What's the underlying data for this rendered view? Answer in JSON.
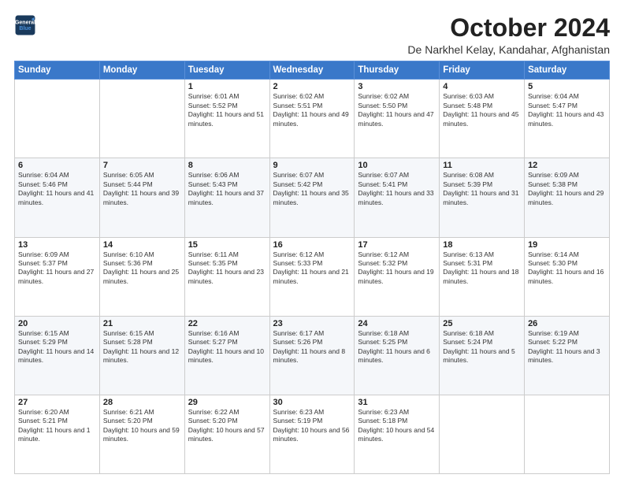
{
  "logo": {
    "line1": "General",
    "line2": "Blue"
  },
  "title": "October 2024",
  "location": "De Narkhel Kelay, Kandahar, Afghanistan",
  "weekdays": [
    "Sunday",
    "Monday",
    "Tuesday",
    "Wednesday",
    "Thursday",
    "Friday",
    "Saturday"
  ],
  "weeks": [
    [
      {
        "day": null
      },
      {
        "day": null
      },
      {
        "day": "1",
        "sunrise": "Sunrise: 6:01 AM",
        "sunset": "Sunset: 5:52 PM",
        "daylight": "Daylight: 11 hours and 51 minutes."
      },
      {
        "day": "2",
        "sunrise": "Sunrise: 6:02 AM",
        "sunset": "Sunset: 5:51 PM",
        "daylight": "Daylight: 11 hours and 49 minutes."
      },
      {
        "day": "3",
        "sunrise": "Sunrise: 6:02 AM",
        "sunset": "Sunset: 5:50 PM",
        "daylight": "Daylight: 11 hours and 47 minutes."
      },
      {
        "day": "4",
        "sunrise": "Sunrise: 6:03 AM",
        "sunset": "Sunset: 5:48 PM",
        "daylight": "Daylight: 11 hours and 45 minutes."
      },
      {
        "day": "5",
        "sunrise": "Sunrise: 6:04 AM",
        "sunset": "Sunset: 5:47 PM",
        "daylight": "Daylight: 11 hours and 43 minutes."
      }
    ],
    [
      {
        "day": "6",
        "sunrise": "Sunrise: 6:04 AM",
        "sunset": "Sunset: 5:46 PM",
        "daylight": "Daylight: 11 hours and 41 minutes."
      },
      {
        "day": "7",
        "sunrise": "Sunrise: 6:05 AM",
        "sunset": "Sunset: 5:44 PM",
        "daylight": "Daylight: 11 hours and 39 minutes."
      },
      {
        "day": "8",
        "sunrise": "Sunrise: 6:06 AM",
        "sunset": "Sunset: 5:43 PM",
        "daylight": "Daylight: 11 hours and 37 minutes."
      },
      {
        "day": "9",
        "sunrise": "Sunrise: 6:07 AM",
        "sunset": "Sunset: 5:42 PM",
        "daylight": "Daylight: 11 hours and 35 minutes."
      },
      {
        "day": "10",
        "sunrise": "Sunrise: 6:07 AM",
        "sunset": "Sunset: 5:41 PM",
        "daylight": "Daylight: 11 hours and 33 minutes."
      },
      {
        "day": "11",
        "sunrise": "Sunrise: 6:08 AM",
        "sunset": "Sunset: 5:39 PM",
        "daylight": "Daylight: 11 hours and 31 minutes."
      },
      {
        "day": "12",
        "sunrise": "Sunrise: 6:09 AM",
        "sunset": "Sunset: 5:38 PM",
        "daylight": "Daylight: 11 hours and 29 minutes."
      }
    ],
    [
      {
        "day": "13",
        "sunrise": "Sunrise: 6:09 AM",
        "sunset": "Sunset: 5:37 PM",
        "daylight": "Daylight: 11 hours and 27 minutes."
      },
      {
        "day": "14",
        "sunrise": "Sunrise: 6:10 AM",
        "sunset": "Sunset: 5:36 PM",
        "daylight": "Daylight: 11 hours and 25 minutes."
      },
      {
        "day": "15",
        "sunrise": "Sunrise: 6:11 AM",
        "sunset": "Sunset: 5:35 PM",
        "daylight": "Daylight: 11 hours and 23 minutes."
      },
      {
        "day": "16",
        "sunrise": "Sunrise: 6:12 AM",
        "sunset": "Sunset: 5:33 PM",
        "daylight": "Daylight: 11 hours and 21 minutes."
      },
      {
        "day": "17",
        "sunrise": "Sunrise: 6:12 AM",
        "sunset": "Sunset: 5:32 PM",
        "daylight": "Daylight: 11 hours and 19 minutes."
      },
      {
        "day": "18",
        "sunrise": "Sunrise: 6:13 AM",
        "sunset": "Sunset: 5:31 PM",
        "daylight": "Daylight: 11 hours and 18 minutes."
      },
      {
        "day": "19",
        "sunrise": "Sunrise: 6:14 AM",
        "sunset": "Sunset: 5:30 PM",
        "daylight": "Daylight: 11 hours and 16 minutes."
      }
    ],
    [
      {
        "day": "20",
        "sunrise": "Sunrise: 6:15 AM",
        "sunset": "Sunset: 5:29 PM",
        "daylight": "Daylight: 11 hours and 14 minutes."
      },
      {
        "day": "21",
        "sunrise": "Sunrise: 6:15 AM",
        "sunset": "Sunset: 5:28 PM",
        "daylight": "Daylight: 11 hours and 12 minutes."
      },
      {
        "day": "22",
        "sunrise": "Sunrise: 6:16 AM",
        "sunset": "Sunset: 5:27 PM",
        "daylight": "Daylight: 11 hours and 10 minutes."
      },
      {
        "day": "23",
        "sunrise": "Sunrise: 6:17 AM",
        "sunset": "Sunset: 5:26 PM",
        "daylight": "Daylight: 11 hours and 8 minutes."
      },
      {
        "day": "24",
        "sunrise": "Sunrise: 6:18 AM",
        "sunset": "Sunset: 5:25 PM",
        "daylight": "Daylight: 11 hours and 6 minutes."
      },
      {
        "day": "25",
        "sunrise": "Sunrise: 6:18 AM",
        "sunset": "Sunset: 5:24 PM",
        "daylight": "Daylight: 11 hours and 5 minutes."
      },
      {
        "day": "26",
        "sunrise": "Sunrise: 6:19 AM",
        "sunset": "Sunset: 5:22 PM",
        "daylight": "Daylight: 11 hours and 3 minutes."
      }
    ],
    [
      {
        "day": "27",
        "sunrise": "Sunrise: 6:20 AM",
        "sunset": "Sunset: 5:21 PM",
        "daylight": "Daylight: 11 hours and 1 minute."
      },
      {
        "day": "28",
        "sunrise": "Sunrise: 6:21 AM",
        "sunset": "Sunset: 5:20 PM",
        "daylight": "Daylight: 10 hours and 59 minutes."
      },
      {
        "day": "29",
        "sunrise": "Sunrise: 6:22 AM",
        "sunset": "Sunset: 5:20 PM",
        "daylight": "Daylight: 10 hours and 57 minutes."
      },
      {
        "day": "30",
        "sunrise": "Sunrise: 6:23 AM",
        "sunset": "Sunset: 5:19 PM",
        "daylight": "Daylight: 10 hours and 56 minutes."
      },
      {
        "day": "31",
        "sunrise": "Sunrise: 6:23 AM",
        "sunset": "Sunset: 5:18 PM",
        "daylight": "Daylight: 10 hours and 54 minutes."
      },
      {
        "day": null
      },
      {
        "day": null
      }
    ]
  ]
}
